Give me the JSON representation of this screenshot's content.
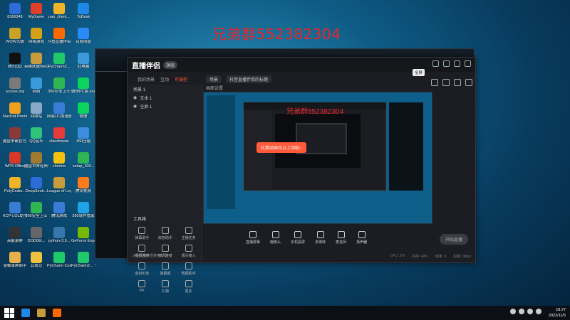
{
  "watermark": "兄弟群552382304",
  "inner_watermark": "兄弟群552382304",
  "desktop_icons": [
    {
      "label": "8366348",
      "color": "#2d6bd6"
    },
    {
      "label": "MyGame",
      "color": "#e0402a"
    },
    {
      "label": "pan_client...",
      "color": "#f0b429"
    },
    {
      "label": "ToDesk",
      "color": "#1e88e5"
    },
    {
      "label": "WOW大脚",
      "color": "#c9a227"
    },
    {
      "label": "网络游戏",
      "color": "#d4a017"
    },
    {
      "label": "斗鱼直播伴侣",
      "color": "#ff6a00"
    },
    {
      "label": "百度网盘",
      "color": "#2a8af6"
    },
    {
      "label": "腾讯QQ",
      "color": "#111111"
    },
    {
      "label": "英雄联盟WeGame版",
      "color": "#c89b3c"
    },
    {
      "label": "PyCharm2...",
      "color": "#1fc96a"
    },
    {
      "label": "此电脑",
      "color": "#3a9ad9"
    },
    {
      "label": "access.org",
      "color": "#7a7a7a"
    },
    {
      "label": "网络",
      "color": "#3a9ad9"
    },
    {
      "label": "360安全卫士",
      "color": "#2fb553"
    },
    {
      "label": "微信PC版.exe",
      "color": "#0bd35d"
    },
    {
      "label": "Navicat Premium",
      "color": "#f0a020"
    },
    {
      "label": "回收站",
      "color": "#8aa8c8"
    },
    {
      "label": "网易UU加速器",
      "color": "#3a7bd5"
    },
    {
      "label": "微信",
      "color": "#0bd35d"
    },
    {
      "label": "魔兽争霸官方对战平台",
      "color": "#8b3a3a"
    },
    {
      "label": "QQ音乐",
      "color": "#31c27c"
    },
    {
      "label": "cloudmusic",
      "color": "#e83a3a"
    },
    {
      "label": "360压缩",
      "color": "#3c8dde"
    },
    {
      "label": "WPS Office",
      "color": "#d9372a"
    },
    {
      "label": "魔兽世界经典怀旧服",
      "color": "#a07a30"
    },
    {
      "label": "chrome",
      "color": "#f4c20d"
    },
    {
      "label": "setup_100...",
      "color": "#2fb553"
    },
    {
      "label": "PolyCoder...",
      "color": "#f0b429"
    },
    {
      "label": "DeepSeek...",
      "color": "#2d6bd6"
    },
    {
      "label": "League of Legends",
      "color": "#c89b3c"
    },
    {
      "label": "腾讯视频",
      "color": "#ff7a1a"
    },
    {
      "label": "KCP-LOL助手",
      "color": "#3a7bd5"
    },
    {
      "label": "360安全卫士",
      "color": "#2fb553"
    },
    {
      "label": "腾讯游戏",
      "color": "#3a7bd5"
    },
    {
      "label": "360软件管家",
      "color": "#1fa3e8"
    },
    {
      "label": "高能录屏",
      "color": "#333333"
    },
    {
      "label": "DODGE...",
      "color": "#666666"
    },
    {
      "label": "python-3.9...",
      "color": "#3776ab"
    },
    {
      "label": "GeForce Experience",
      "color": "#76b900"
    },
    {
      "label": "金蝶录屏助手",
      "color": "#e8b04a"
    },
    {
      "label": "云笔记",
      "color": "#f0c040"
    },
    {
      "label": "PyCharm Communi...",
      "color": "#1fc96a"
    },
    {
      "label": "PyCharm2... 专业版(win...",
      "color": "#1fc96a"
    }
  ],
  "app": {
    "title": "直播伴侣",
    "badge": "旗舰",
    "tabs": [
      "我的场景",
      "互动",
      "可操控"
    ],
    "scenes": [
      "场景 1",
      "文本 1",
      "全屏 1"
    ],
    "center_tab": "场景",
    "stream_title": "抖音直播伴侣的标题",
    "sub_label": "画面设置",
    "tools_label": "工具箱",
    "tools": [
      {
        "label": "弹幕助手"
      },
      {
        "label": "房管助手"
      },
      {
        "label": "主播任务"
      },
      {
        "label": "视频连麦"
      },
      {
        "label": "多人连麦"
      },
      {
        "label": "观众接入"
      },
      {
        "label": "虚拟形象"
      },
      {
        "label": "弹幕姬"
      },
      {
        "label": "数据助手"
      },
      {
        "label": "PK"
      },
      {
        "label": "礼物"
      },
      {
        "label": "更多"
      }
    ],
    "footer": "斗鱼直播伴侣使用帮助",
    "bottom_items": [
      "直播屏幕",
      "摄像头",
      "手机投屏",
      "多媒体",
      "麦克风",
      "扬声器"
    ],
    "start_button": "开始直播",
    "status": [
      "CPU: 2%",
      "内存: 40%",
      "帧率: 0",
      "码率: 0kb/s"
    ],
    "tooltip": "全屏",
    "toast": "礼物动画可以上场啦~"
  },
  "taskbar": {
    "time": "18:27",
    "date": "2022/11/5"
  }
}
